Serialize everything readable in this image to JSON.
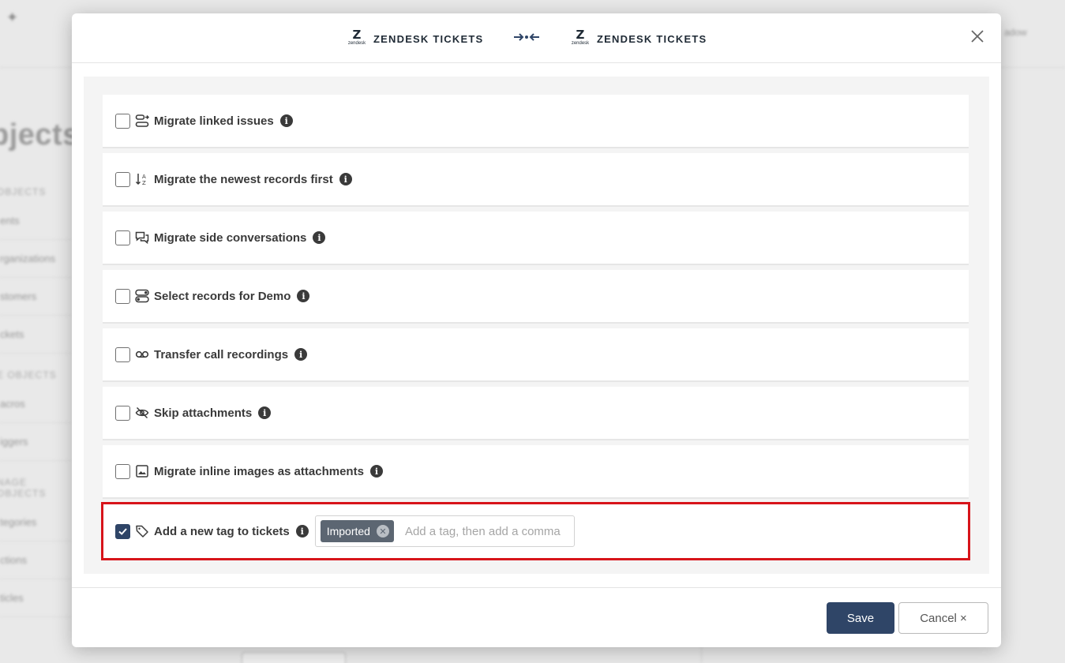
{
  "background": {
    "page_title_fragment": "bjects",
    "topright_fragment": "adow",
    "sidebar_sections": [
      {
        "heading": "OBJECTS",
        "items": [
          "ents",
          "rganizations",
          "stomers",
          "ckets"
        ]
      },
      {
        "heading": "E OBJECTS",
        "items": [
          "acros",
          "iggers"
        ]
      },
      {
        "heading": "NAGE OBJECTS",
        "items": [
          "tegories",
          "ctions",
          "ticles"
        ]
      }
    ]
  },
  "modal": {
    "source": {
      "logo_mark": "Z",
      "logo_word": "zendesk",
      "name": "ZENDESK TICKETS"
    },
    "target": {
      "logo_mark": "Z",
      "logo_word": "zendesk",
      "name": "ZENDESK TICKETS"
    },
    "close_icon": "close-icon",
    "options": [
      {
        "label": "Migrate linked issues",
        "checked": false,
        "icon": "linked-issues-icon"
      },
      {
        "label": "Migrate the newest records first",
        "checked": false,
        "icon": "sort-icon"
      },
      {
        "label": "Migrate side conversations",
        "checked": false,
        "icon": "conversations-icon"
      },
      {
        "label": "Select records for Demo",
        "checked": false,
        "icon": "toggle-records-icon"
      },
      {
        "label": "Transfer call recordings",
        "checked": false,
        "icon": "voicemail-icon"
      },
      {
        "label": "Skip attachments",
        "checked": false,
        "icon": "eye-slash-icon"
      },
      {
        "label": "Migrate inline images as attachments",
        "checked": false,
        "icon": "image-icon"
      },
      {
        "label": "Add a new tag to tickets",
        "checked": true,
        "icon": "tag-icon"
      }
    ],
    "info_glyph": "i",
    "tag_field": {
      "tags": [
        "Imported"
      ],
      "remove_glyph": "✕",
      "placeholder": "Add a tag, then add a comma"
    },
    "footer": {
      "save_label": "Save",
      "cancel_label": "Cancel ×"
    },
    "colors": {
      "primary": "#2f4567",
      "highlight": "#d7141a",
      "chip": "#5c6672"
    }
  }
}
